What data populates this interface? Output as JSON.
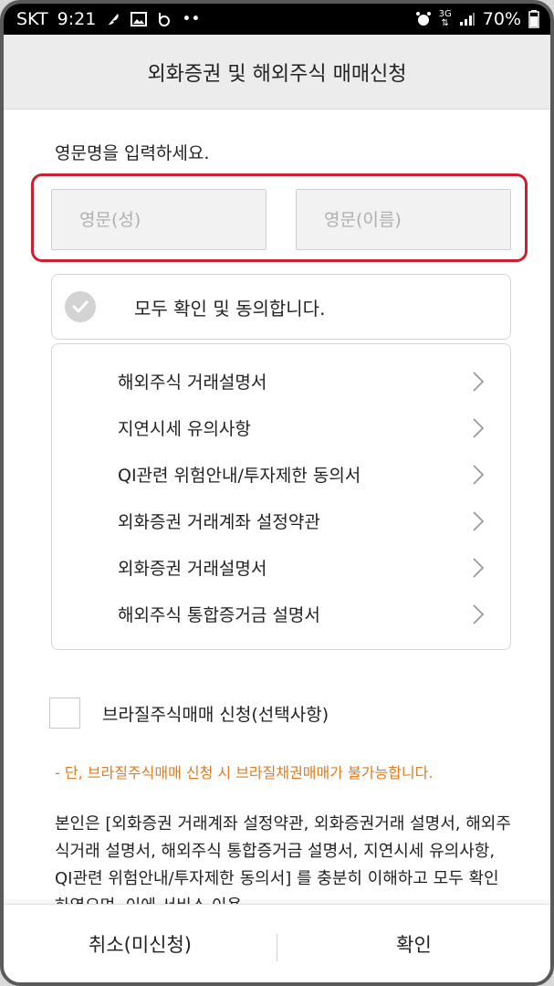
{
  "status_bar": {
    "carrier": "SKT",
    "time": "9:21",
    "network": "3G",
    "battery": "70%"
  },
  "header": {
    "title": "외화증권 및 해외주식 매매신청"
  },
  "name_section": {
    "prompt": "영문명을 입력하세요.",
    "last_name": {
      "value": "",
      "placeholder": "영문(성)"
    },
    "first_name": {
      "value": "",
      "placeholder": "영문(이름)"
    }
  },
  "agree_all": {
    "label": "모두 확인 및 동의합니다.",
    "checked": false
  },
  "documents": [
    {
      "label": "해외주식 거래설명서"
    },
    {
      "label": "지연시세 유의사항"
    },
    {
      "label": "QI관련 위험안내/투자제한 동의서"
    },
    {
      "label": "외화증권 거래계좌 설정약관"
    },
    {
      "label": "외화증권 거래설명서"
    },
    {
      "label": "해외주식 통합증거금 설명서"
    }
  ],
  "brazil_option": {
    "label": "브라질주식매매 신청(선택사항)",
    "checked": false
  },
  "notice": "- 단, 브라질주식매매 신청 시 브라질채권매매가 불가능합니다.",
  "consent_text": "본인은 [외화증권 거래계좌 설정약관, 외화증권거래 설명서, 해외주식거래 설명서, 해외주식 통합증거금 설명서, 지연시세 유의사항, QI관련 위험안내/투자제한 동의서] 를 충분히 이해하고 모두 확인하였으며, 이에 서비스 이용",
  "footer": {
    "cancel_label": "취소(미신청)",
    "confirm_label": "확인"
  },
  "colors": {
    "highlight": "#cc1f2f",
    "notice": "#e07b21"
  }
}
